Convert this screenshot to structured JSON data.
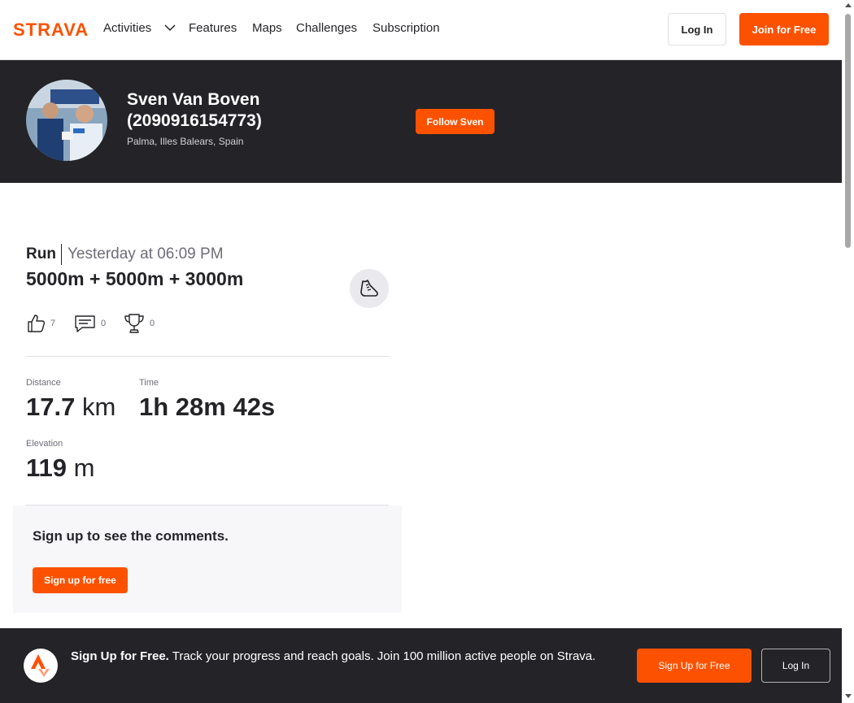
{
  "brand": {
    "logo_text": "STRAVA",
    "accent": "#fc5200",
    "dark": "#242428"
  },
  "nav": {
    "activities": "Activities",
    "features": "Features",
    "maps": "Maps",
    "challenges": "Challenges",
    "subscription": "Subscription",
    "login": "Log In",
    "join": "Join for Free"
  },
  "athlete": {
    "name": "Sven Van Boven (2090916154773)",
    "location": "Palma, Illes Balears, Spain",
    "follow_label": "Follow Sven"
  },
  "activity": {
    "sport": "Run",
    "date": "Yesterday at 06:09 PM",
    "title": "5000m + 5000m + 3000m",
    "kudos": "7",
    "comments": "0",
    "achievements": "0",
    "stats": {
      "distance_label": "Distance",
      "distance_value": "17.7",
      "distance_unit": " km",
      "time_label": "Time",
      "time_value": "1h 28m 42s",
      "elevation_label": "Elevation",
      "elevation_value": "119",
      "elevation_unit": " m"
    }
  },
  "comments_cta": {
    "text": "Sign up to see the comments.",
    "button": "Sign up for free"
  },
  "bottom_cta": {
    "bold": "Sign Up for Free.",
    "text": " Track your progress and reach goals. Join 100 million active people on Strava.",
    "signup": "Sign Up for Free",
    "login": "Log In"
  },
  "icons": [
    "chevron-down-icon",
    "shoe-icon",
    "thumbs-up-icon",
    "comment-icon",
    "trophy-icon",
    "strava-mark-icon"
  ]
}
